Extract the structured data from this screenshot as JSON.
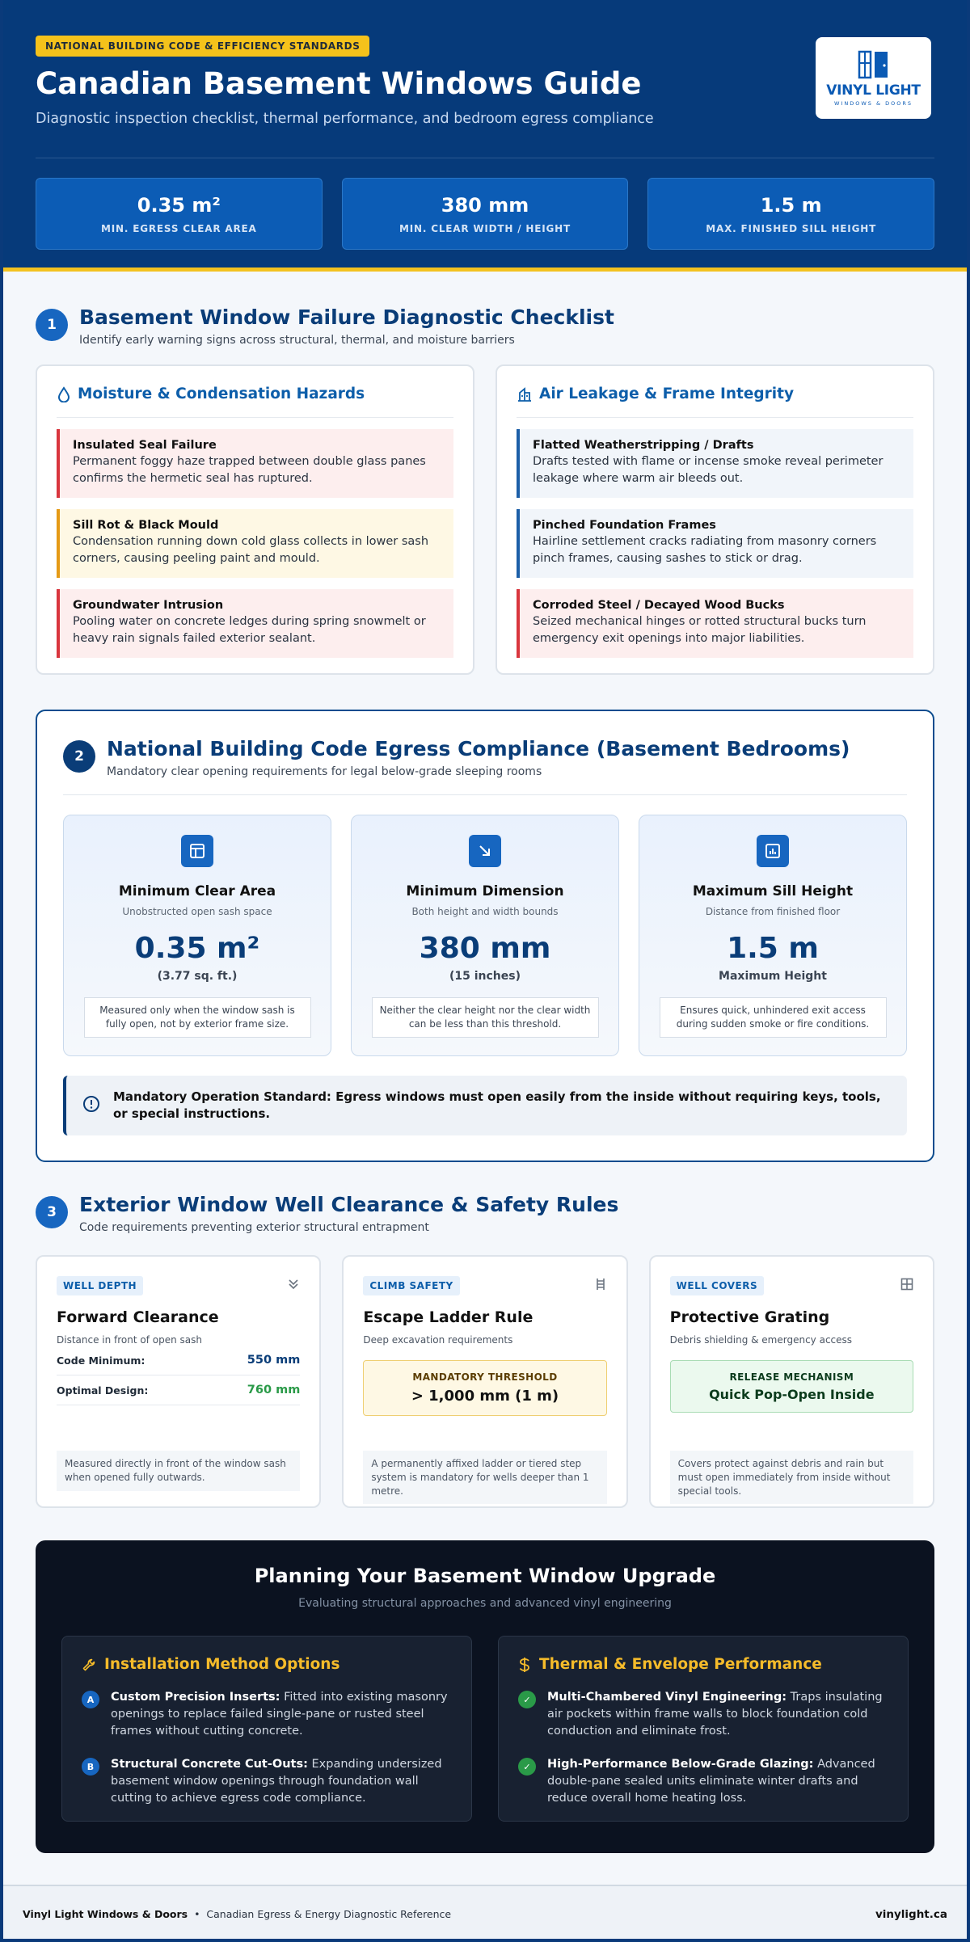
{
  "hero": {
    "badge": "NATIONAL BUILDING CODE & EFFICIENCY STANDARDS",
    "title": "Canadian Basement Windows Guide",
    "subtitle": "Diagnostic inspection checklist, thermal performance, and bedroom egress compliance",
    "logo_name": "VINYL LIGHT",
    "logo_tag": "WINDOWS & DOORS",
    "stats": [
      {
        "value": "0.35 m²",
        "label": "MIN. EGRESS CLEAR AREA"
      },
      {
        "value": "380 mm",
        "label": "MIN. CLEAR WIDTH / HEIGHT"
      },
      {
        "value": "1.5 m",
        "label": "MAX. FINISHED SILL HEIGHT"
      }
    ]
  },
  "section1": {
    "number": "1",
    "title": "Basement Window Failure Diagnostic Checklist",
    "subtitle": "Identify early warning signs across structural, thermal, and moisture barriers",
    "moisture": {
      "title": "Moisture & Condensation Hazards",
      "items": [
        {
          "title": "Insulated Seal Failure",
          "desc": "Permanent foggy haze trapped between double glass panes confirms the hermetic seal has ruptured."
        },
        {
          "title": "Sill Rot & Black Mould",
          "desc": "Condensation running down cold glass collects in lower sash corners, causing peeling paint and mould."
        },
        {
          "title": "Groundwater Intrusion",
          "desc": "Pooling water on concrete ledges during spring snowmelt or heavy rain signals failed exterior sealant."
        }
      ]
    },
    "air": {
      "title": "Air Leakage & Frame Integrity",
      "items": [
        {
          "title": "Flatted Weatherstripping / Drafts",
          "desc": "Drafts tested with flame or incense smoke reveal perimeter leakage where warm air bleeds out."
        },
        {
          "title": "Pinched Foundation Frames",
          "desc": "Hairline settlement cracks radiating from masonry corners pinch frames, causing sashes to stick or drag."
        },
        {
          "title": "Corroded Steel / Decayed Wood Bucks",
          "desc": "Seized mechanical hinges or rotted structural bucks turn emergency exit openings into major liabilities."
        }
      ]
    }
  },
  "section2": {
    "number": "2",
    "title": "National Building Code Egress Compliance (Basement Bedrooms)",
    "subtitle": "Mandatory clear opening requirements for legal below-grade sleeping rooms",
    "cards": [
      {
        "title": "Minimum Clear Area",
        "sub": "Unobstructed open sash space",
        "value": "0.35 m²",
        "unit": "(3.77 sq. ft.)",
        "note": "Measured only when the window sash is fully open, not by exterior frame size."
      },
      {
        "title": "Minimum Dimension",
        "sub": "Both height and width bounds",
        "value": "380 mm",
        "unit": "(15 inches)",
        "note": "Neither the clear height nor the clear width can be less than this threshold."
      },
      {
        "title": "Maximum Sill Height",
        "sub": "Distance from finished floor",
        "value": "1.5 m",
        "unit": "Maximum Height",
        "note": "Ensures quick, unhindered exit access during sudden smoke or fire conditions."
      }
    ],
    "mandatory": "Mandatory Operation Standard: Egress windows must open easily from the inside without requiring keys, tools, or special instructions."
  },
  "section3": {
    "number": "3",
    "title": "Exterior Window Well Clearance & Safety Rules",
    "subtitle": "Code requirements preventing exterior structural entrapment",
    "depth": {
      "tag": "WELL DEPTH",
      "title": "Forward Clearance",
      "sub": "Distance in front of open sash",
      "rows": [
        {
          "label": "Code Minimum:",
          "value": "550 mm"
        },
        {
          "label": "Optimal Design:",
          "value": "760 mm"
        }
      ],
      "foot": "Measured directly in front of the window sash when opened fully outwards."
    },
    "climb": {
      "tag": "CLIMB SAFETY",
      "title": "Escape Ladder Rule",
      "sub": "Deep excavation requirements",
      "box_label": "MANDATORY THRESHOLD",
      "box_value": "> 1,000 mm (1 m)",
      "foot": "A permanently affixed ladder or tiered step system is mandatory for wells deeper than 1 metre."
    },
    "covers": {
      "tag": "WELL COVERS",
      "title": "Protective Grating",
      "sub": "Debris shielding & emergency access",
      "box_label": "RELEASE MECHANISM",
      "box_value": "Quick Pop-Open Inside",
      "foot": "Covers protect against debris and rain but must open immediately from inside without special tools."
    }
  },
  "planning": {
    "title": "Planning Your Basement Window Upgrade",
    "subtitle": "Evaluating structural approaches and advanced vinyl engineering",
    "install": {
      "title": "Installation Method Options",
      "items": [
        {
          "badge": "A",
          "title": "Custom Precision Inserts:",
          "desc": "Fitted into existing masonry openings to replace failed single-pane or rusted steel frames without cutting concrete."
        },
        {
          "badge": "B",
          "title": "Structural Concrete Cut-Outs:",
          "desc": "Expanding undersized basement window openings through foundation wall cutting to achieve egress code compliance."
        }
      ]
    },
    "thermal": {
      "title": "Thermal & Envelope Performance",
      "items": [
        {
          "badge": "✓",
          "title": "Multi-Chambered Vinyl Engineering:",
          "desc": "Traps insulating air pockets within frame walls to block foundation cold conduction and eliminate frost."
        },
        {
          "badge": "✓",
          "title": "High-Performance Below-Grade Glazing:",
          "desc": "Advanced double-pane sealed units eliminate winter drafts and reduce overall home heating loss."
        }
      ]
    }
  },
  "footer": {
    "brand": "Vinyl Light Windows & Doors",
    "sep": "•",
    "ref": "Canadian Egress & Energy Diagnostic Reference",
    "site": "vinylight.ca"
  },
  "colors": {
    "navy": "#063a7a",
    "accent_blue": "#1766c0",
    "gold": "#f5c21b",
    "danger": "#d9363e",
    "warning": "#e59a16",
    "success": "#2a9a48",
    "optimal_green": "#2a9a48",
    "dark_panel": "#0b1220"
  }
}
